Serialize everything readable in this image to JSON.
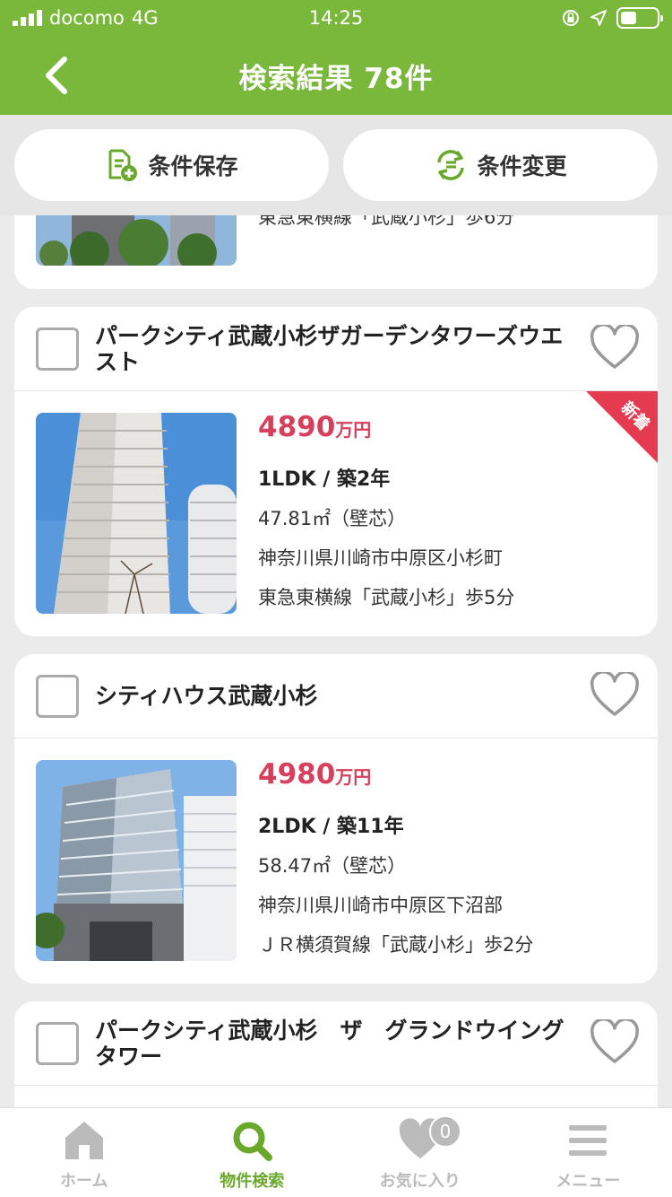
{
  "status": {
    "carrier": "docomo",
    "network": "4G",
    "time": "14:25"
  },
  "nav": {
    "title": "検索結果 78件"
  },
  "actions": {
    "save_label": "条件保存",
    "change_label": "条件変更"
  },
  "partial_card": {
    "line": "東急東横線「武蔵小杉」歩6分"
  },
  "listings": [
    {
      "name": "パークシティ武蔵小杉ザガーデンタワーズウエスト",
      "price": "4890",
      "price_unit": "万円",
      "layout": "1LDK / 築2年",
      "area": "47.81㎡（壁芯）",
      "address": "神奈川県川崎市中原区小杉町",
      "access": "東急東横線「武蔵小杉」歩5分",
      "badge": "新着"
    },
    {
      "name": "シティハウス武蔵小杉",
      "price": "4980",
      "price_unit": "万円",
      "layout": "2LDK / 築11年",
      "area": "58.47㎡（壁芯）",
      "address": "神奈川県川崎市中原区下沼部",
      "access": "ＪＲ横須賀線「武蔵小杉」歩2分"
    },
    {
      "name": "パークシティ武蔵小杉　ザ　グランドウイングタワー"
    }
  ],
  "tabs": {
    "home": "ホーム",
    "search": "物件検索",
    "favorites": "お気に入り",
    "favorites_count": "0",
    "menu": "メニュー"
  },
  "colors": {
    "brand_green": "#7ab83c",
    "price_red": "#d6405c",
    "badge_red": "#e43b50"
  }
}
